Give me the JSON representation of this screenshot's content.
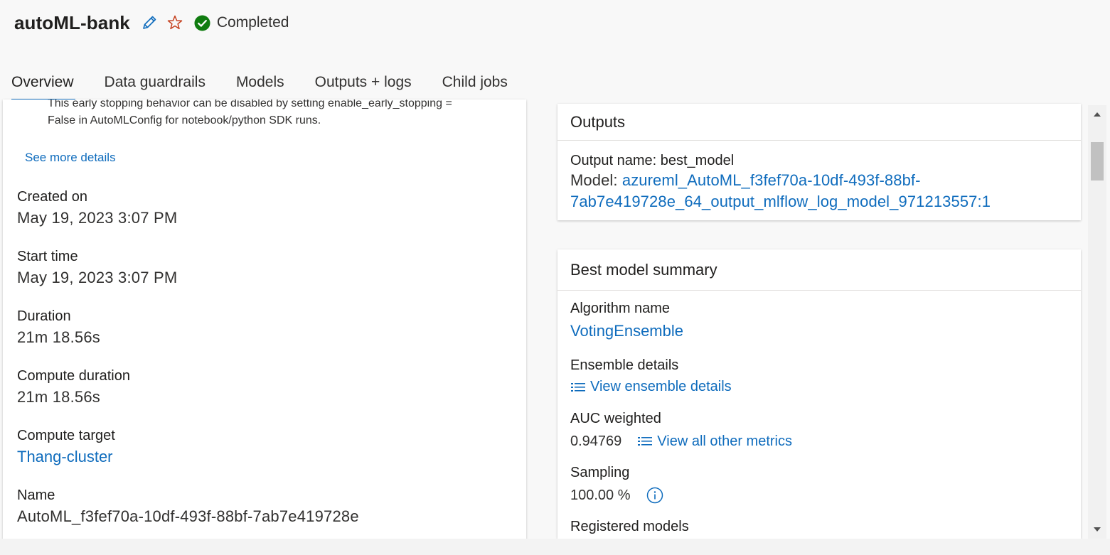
{
  "header": {
    "job_title": "autoML-bank",
    "status_text": "Completed",
    "status_color": "#107c10"
  },
  "tabs": [
    {
      "label": "Overview",
      "active": true
    },
    {
      "label": "Data guardrails",
      "active": false
    },
    {
      "label": "Models",
      "active": false
    },
    {
      "label": "Outputs + logs",
      "active": false
    },
    {
      "label": "Child jobs",
      "active": false
    }
  ],
  "left": {
    "note_line1": "This early stopping behavior can be disabled by setting enable_early_stopping =",
    "note_line2": "False in AutoMLConfig for notebook/python SDK runs.",
    "see_more": "See more details",
    "created_on_label": "Created on",
    "created_on_value": "May 19, 2023 3:07 PM",
    "start_time_label": "Start time",
    "start_time_value": "May 19, 2023 3:07 PM",
    "duration_label": "Duration",
    "duration_value": "21m 18.56s",
    "compute_duration_label": "Compute duration",
    "compute_duration_value": "21m 18.56s",
    "compute_target_label": "Compute target",
    "compute_target_value": "Thang-cluster",
    "name_label": "Name",
    "name_value": "AutoML_f3fef70a-10df-493f-88bf-7ab7e419728e"
  },
  "outputs": {
    "title": "Outputs",
    "output_name": "Output name: best_model",
    "model_prefix": "Model: ",
    "model_link_line1": "azureml_AutoML_f3fef70a-10df-493f-88bf-",
    "model_link_line2": "7ab7e419728e_64_output_mlflow_log_model_971213557:1"
  },
  "summary": {
    "title": "Best model summary",
    "algorithm_label": "Algorithm name",
    "algorithm_value": "VotingEnsemble",
    "ensemble_label": "Ensemble details",
    "ensemble_link": "View ensemble details",
    "auc_label": "AUC weighted",
    "auc_value": "0.94769",
    "metrics_link": "View all other metrics",
    "sampling_label": "Sampling",
    "sampling_value": "100.00 %",
    "registered_label": "Registered models"
  },
  "icons": {
    "edit": "pencil-icon",
    "favorite": "star-icon",
    "status": "check-circle-icon",
    "list": "list-icon",
    "info": "info-icon"
  },
  "colors": {
    "link": "#0f6cbd",
    "accent": "#0f6cbd",
    "favorite": "#c43e1c"
  }
}
